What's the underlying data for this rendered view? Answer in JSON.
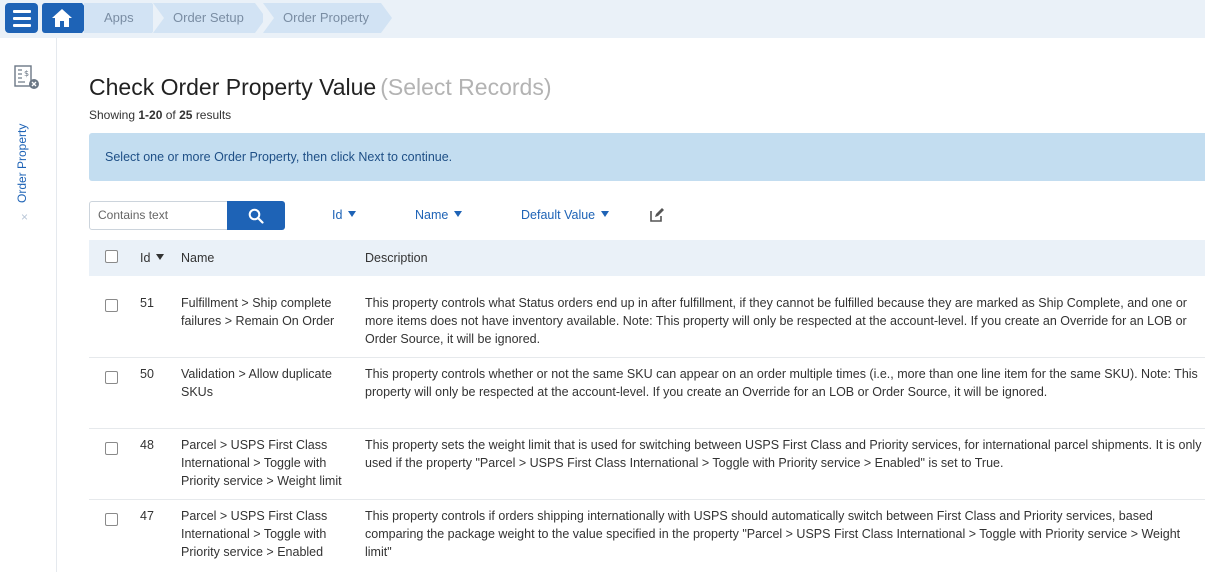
{
  "breadcrumb": {
    "items": [
      "Apps",
      "Order Setup",
      "Order Property"
    ]
  },
  "sidebar": {
    "label": "Order Property",
    "close_glyph": "×"
  },
  "page": {
    "title": "Check Order Property Value",
    "subtitle": "(Select Records)",
    "showing_prefix": "Showing",
    "showing_range": "1-20",
    "showing_of": "of",
    "showing_total": "25",
    "showing_suffix": "results"
  },
  "notice": "Select one or more Order Property, then click Next to continue.",
  "search": {
    "placeholder": "Contains text"
  },
  "filters": [
    "Id",
    "Name",
    "Default Value"
  ],
  "table": {
    "headers": {
      "id": "Id",
      "name": "Name",
      "description": "Description"
    },
    "rows": [
      {
        "id": "51",
        "name": "Fulfillment > Ship complete failures > Remain On Order",
        "description": "This property controls what Status orders end up in after fulfillment, if they cannot be fulfilled because they are marked as Ship Complete, and one or more items does not have inventory available. Note: This property will only be respected at the account-level. If you create an Override for an LOB or Order Source, it will be ignored."
      },
      {
        "id": "50",
        "name": "Validation > Allow duplicate SKUs",
        "description": "This property controls whether or not the same SKU can appear on an order multiple times (i.e., more than one line item for the same SKU). Note: This property will only be respected at the account-level. If you create an Override for an LOB or Order Source, it will be ignored."
      },
      {
        "id": "48",
        "name": "Parcel > USPS First Class International > Toggle with Priority service > Weight limit",
        "description": "This property sets the weight limit that is used for switching between USPS First Class and Priority services, for international parcel shipments. It is only used if the property \"Parcel > USPS First Class International > Toggle with Priority service > Enabled\" is set to True."
      },
      {
        "id": "47",
        "name": "Parcel > USPS First Class International > Toggle with Priority service > Enabled",
        "description": "This property controls if orders shipping internationally with USPS should automatically switch between First Class and Priority services, based comparing the package weight to the value specified in the property \"Parcel > USPS First Class International > Toggle with Priority service > Weight limit\""
      }
    ]
  }
}
